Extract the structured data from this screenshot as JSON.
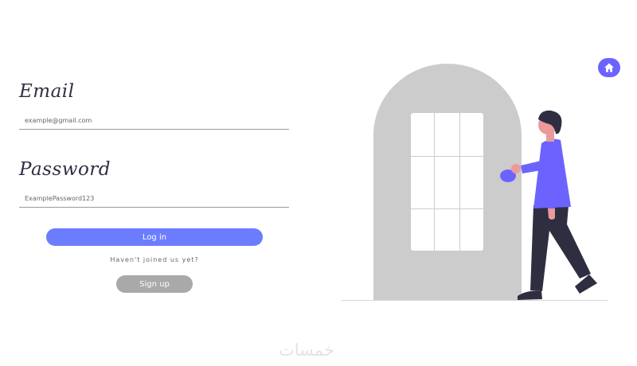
{
  "form": {
    "email_label": "Email",
    "email_placeholder": "example@gmail.com",
    "password_label": "Password",
    "password_placeholder": "ExamplePassword123",
    "login_label": "Log in",
    "signup_prompt": "Haven't joined us yet?",
    "signup_label": "Sign up"
  },
  "nav": {
    "home_icon": "home-icon"
  },
  "illustration": {
    "name": "person-opening-door"
  },
  "watermark": "خمسات",
  "colors": {
    "primary": "#6c7cff",
    "accent": "#6c63ff",
    "secondary_button": "#a9a9a9",
    "door": "#cccccc",
    "dark": "#2f2e41"
  }
}
